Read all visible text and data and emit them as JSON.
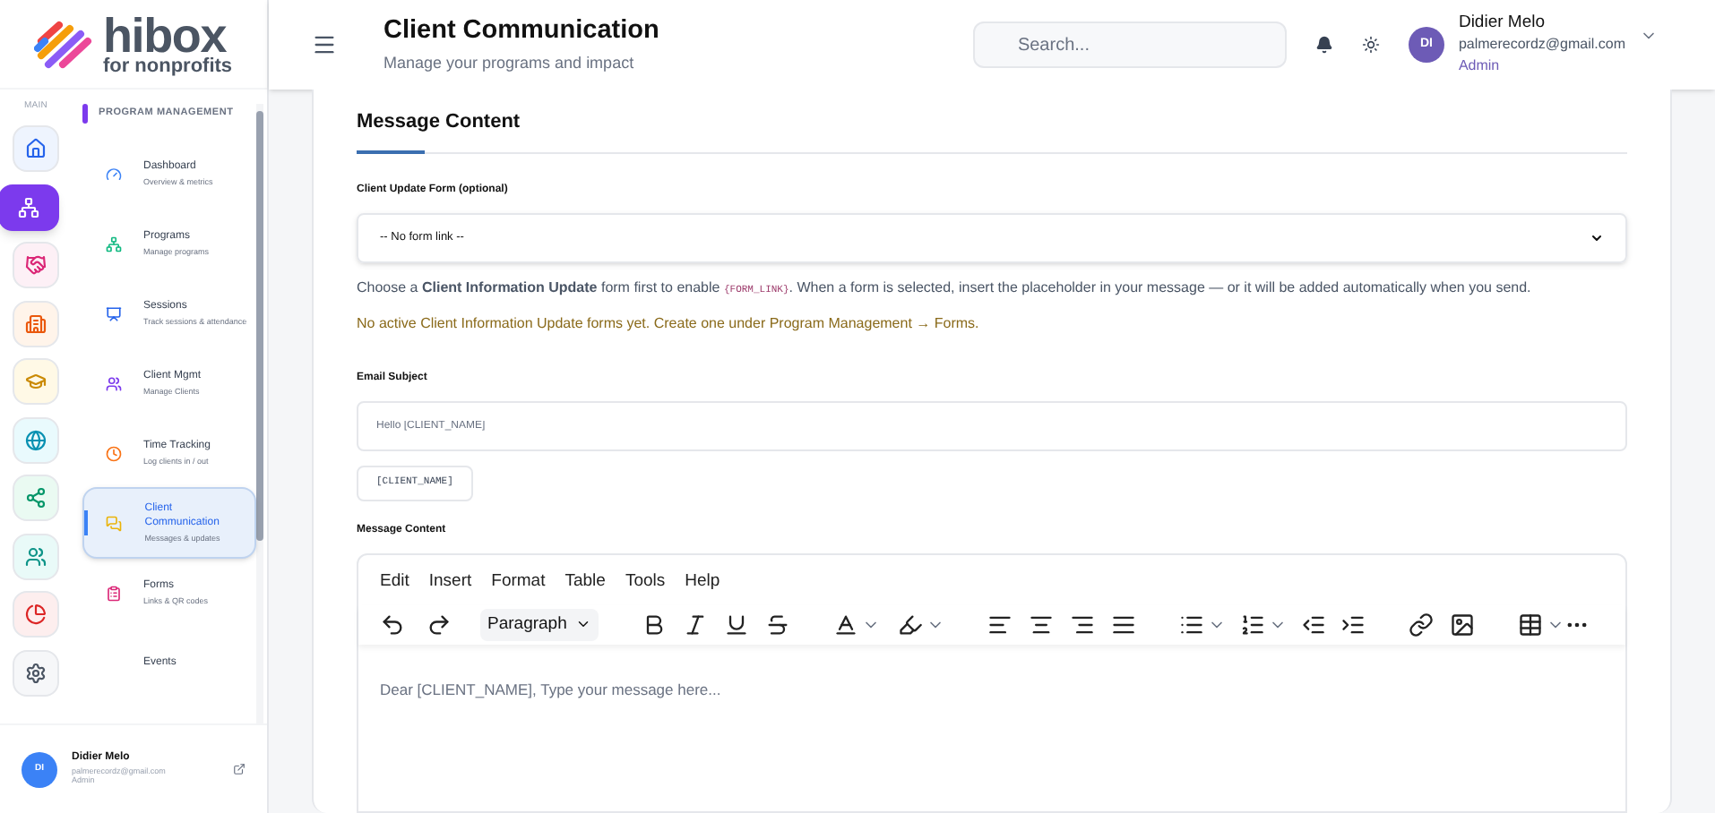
{
  "logo": {
    "name": "hibox",
    "tagline": "for nonprofits"
  },
  "rail": {
    "label": "MAIN",
    "items": [
      {
        "selected": false
      },
      {
        "selected": true
      },
      {
        "selected": false
      },
      {
        "selected": false
      },
      {
        "selected": false
      },
      {
        "selected": false
      },
      {
        "selected": false
      },
      {
        "selected": false
      },
      {
        "selected": false
      },
      {
        "selected": false
      }
    ]
  },
  "submenu": {
    "title": "PROGRAM MANAGEMENT",
    "items": [
      {
        "label": "Dashboard",
        "sub": "Overview & metrics",
        "selected": false
      },
      {
        "label": "Programs",
        "sub": "Manage programs",
        "selected": false
      },
      {
        "label": "Sessions",
        "sub": "Track sessions & attendance",
        "selected": false
      },
      {
        "label": "Client Mgmt",
        "sub": "Manage Clients",
        "selected": false
      },
      {
        "label": "Time Tracking",
        "sub": "Log clients in / out",
        "selected": false
      },
      {
        "label": "Client Communication",
        "sub": "Messages & updates",
        "selected": true
      },
      {
        "label": "Forms",
        "sub": "Links & QR codes",
        "selected": false
      },
      {
        "label": "Events",
        "selected": false
      }
    ]
  },
  "user": {
    "initials": "DI",
    "name": "Didier Melo",
    "email": "palmerecordz@gmail.com",
    "role": "Admin"
  },
  "header": {
    "title": "Client Communication",
    "subtitle": "Manage your programs and impact",
    "search_placeholder": "Search...",
    "user": {
      "initials": "DI",
      "name": "Didier Melo",
      "email": "palmerecordz@gmail.com",
      "role": "Admin"
    }
  },
  "card": {
    "title": "Message Content",
    "form_label": "Client Update Form (optional)",
    "form_value": "-- No form link --",
    "help": "Choose a **Client Information Update** form first to enable",
    "help_code": "{FORM_LINK}",
    "help_end": ". When a form is selected, insert the placeholder in your message — or it will be added automatically when you send.",
    "warning": "No active Client Information Update forms yet. Create one under Program Management → Forms.",
    "subject_label": "Email Subject",
    "subject_placeholder": "Hello [CLIENT_NAME]",
    "token": "[CLIENT_NAME]",
    "content_label": "Message Content",
    "editor": {
      "menu": [
        "Edit",
        "Insert",
        "Format",
        "Table",
        "Tools",
        "Help"
      ],
      "block_format": "Paragraph",
      "placeholder": "Dear [CLIENT_NAME], Type your message here..."
    }
  }
}
